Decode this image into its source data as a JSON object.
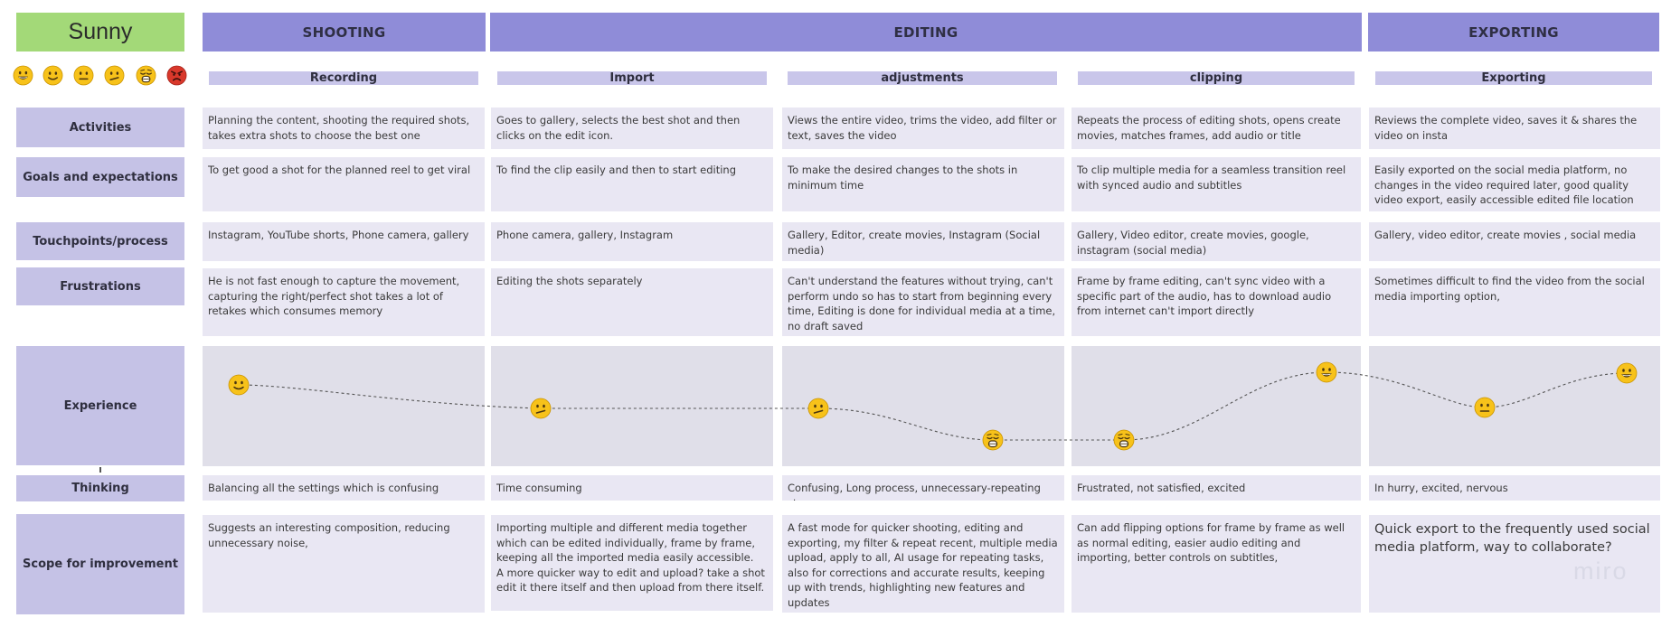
{
  "persona": "Sunny",
  "emotion_scale": [
    "grinning-face-icon",
    "slight-smile-face-icon",
    "neutral-face-icon",
    "confused-face-icon",
    "anguished-face-icon",
    "angry-face-icon"
  ],
  "phases": [
    "SHOOTING",
    "EDITING",
    "EXPORTING"
  ],
  "stages": [
    "Recording",
    "Import",
    "adjustments",
    "clipping",
    "Exporting"
  ],
  "row_labels": {
    "activities": "Activities",
    "goals": "Goals and expectations",
    "touchpoints": "Touchpoints/process",
    "frustrations": "Frustrations",
    "experience": "Experience",
    "thinking": "Thinking",
    "scope": "Scope for improvement"
  },
  "rows": {
    "activities": [
      "Planning the content, shooting the required shots, takes extra shots to choose the best one",
      "Goes to gallery, selects the best shot and then clicks on the edit icon.",
      "Views the entire video, trims the video, add filter or text, saves the video",
      "Repeats the process of editing shots, opens create movies, matches frames, add audio or title",
      "Reviews the complete video, saves it & shares the video on insta"
    ],
    "goals": [
      "To get good a shot for the planned reel to get viral",
      "To find the clip easily and then to start editing",
      "To make the desired changes to the shots in minimum time",
      "To clip multiple media for a seamless transition reel with synced audio and subtitles",
      "Easily exported on the social media platform, no changes in the video required later, good quality video export, easily accessible edited file location"
    ],
    "touchpoints": [
      "Instagram, YouTube shorts, Phone camera, gallery",
      "Phone camera, gallery, Instagram",
      "Gallery, Editor, create movies, Instagram (Social media)",
      "Gallery, Video editor, create movies, google, instagram (social media)",
      "Gallery, video editor, create movies , social media"
    ],
    "frustrations": [
      "He is not fast enough to capture the movement, capturing the right/perfect shot takes a lot of retakes which consumes memory",
      "Editing the shots separately",
      "Can't understand the features without trying, can't perform undo so has to start from beginning every time, Editing is done for individual media at a time, no draft saved",
      "Frame by frame editing, can't sync video with a specific part of the audio, has to download audio from internet can't import directly",
      "Sometimes difficult to find the video from the social media importing option,"
    ],
    "thinking": [
      "Balancing all the settings which is confusing",
      "Time consuming",
      "Confusing, Long process, unnecessary-repeating steps",
      "Frustrated, not satisfied, excited",
      "In hurry, excited, nervous"
    ],
    "scope": [
      "Suggests an interesting composition, reducing unnecessary noise,",
      "Importing multiple and different media together which can be edited individually, frame by frame, keeping all the imported media easily accessible.\nA more quicker way to edit and upload? take a shot edit it there itself and then upload from there itself.",
      "A fast mode for quicker shooting, editing and exporting, my filter & repeat recent, multiple media upload, apply to all, AI usage for repeating tasks, also for corrections and accurate results, keeping up with trends, highlighting new features and updates",
      "Can add flipping options for frame by frame as well as normal editing, easier audio editing and importing, better controls on subtitles,",
      "Quick export to the frequently used social media platform, way to collaborate?"
    ]
  },
  "experience_points": [
    {
      "emotion": "slight-smile-face-icon"
    },
    {
      "emotion": "confused-face-icon"
    },
    {
      "emotion": "confused-face-icon"
    },
    {
      "emotion": "anguished-face-icon"
    },
    {
      "emotion": "anguished-face-icon"
    },
    {
      "emotion": "grinning-face-icon"
    },
    {
      "emotion": "neutral-face-icon"
    },
    {
      "emotion": "grinning-face-icon"
    }
  ],
  "watermark": "miro",
  "colors": {
    "persona": "#a3d978",
    "phase": "#8f8cd8",
    "stage": "#c9c6ea",
    "row_label": "#c5c2e6",
    "cell": "#e9e7f3",
    "experience_cell": "#e0dfe9",
    "emoji_yellow": "#f7c21a",
    "emoji_red": "#d9382b"
  }
}
